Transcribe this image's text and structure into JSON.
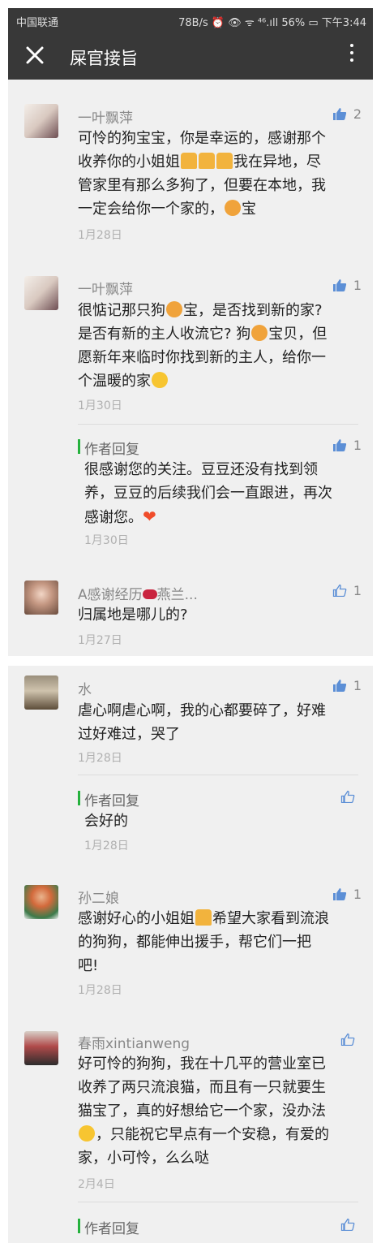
{
  "status_bar": {
    "carrier": "中国联通",
    "right": "78B/s ⏰ 👁 ᯤ ⁴⁶.ıll 56% ▭ 下午3:44"
  },
  "app_bar": {
    "title": "屎官接旨"
  },
  "colors": {
    "bar": "#383838",
    "panel": "#f0f0f0",
    "reply_accent": "#25b13d",
    "thumb": "#5c8fd6"
  },
  "comments": [
    {
      "name": "一叶飘萍",
      "likes": "2",
      "lines": [
        "可怜的狗宝宝，你是幸运的，感谢那个",
        "收养你的小姐姐",
        "我在异地，尽",
        "管家里有那么多狗了，但要在本地，我",
        "一定会给你一个家的，",
        "宝"
      ],
      "date": "1月28日"
    },
    {
      "name": "一叶飘萍",
      "likes": "1",
      "lines": [
        "很惦记那只狗",
        "宝，是否找到新的家?",
        "是否有新的主人收流它? 狗",
        "宝贝，但",
        "愿新年来临时你找到新的主人，给你一",
        "个温暖的家"
      ],
      "date": "1月30日",
      "reply": {
        "label": "作者回复",
        "likes": "1",
        "lines": [
          "很感谢您的关注。豆豆还没有找到领",
          "养，豆豆的后续我们会一直跟进，再次",
          "感谢您。"
        ],
        "date": "1月30日"
      }
    },
    {
      "name": "A感谢经历",
      "name_suffix": "燕兰...",
      "likes": "1",
      "lines": [
        "归属地是哪儿的?"
      ],
      "date": "1月27日"
    },
    {
      "name": "水",
      "likes": "1",
      "lines": [
        "虐心啊虐心啊，我的心都要碎了，好难",
        "过好难过，哭了"
      ],
      "date": "1月28日",
      "reply": {
        "label": "作者回复",
        "lines": [
          "会好的"
        ],
        "date": "1月28日"
      }
    },
    {
      "name": "孙二娘",
      "likes": "1",
      "lines": [
        "感谢好心的小姐姐",
        "希望大家看到流浪",
        "的狗狗，都能伸出援手，帮它们一把",
        "吧!"
      ],
      "date": "1月28日"
    },
    {
      "name": "春雨xintianweng",
      "lines": [
        "好可怜的狗狗，我在十几平的营业室已",
        "收养了两只流浪猫，而且有一只就要生",
        "猫宝了，真的好想给它一个家，没办法",
        "，只能祝它早点有一个安稳，有爱的",
        "家，小可怜，么么哒"
      ],
      "date": "2月4日",
      "reply": {
        "label": "作者回复"
      }
    }
  ]
}
